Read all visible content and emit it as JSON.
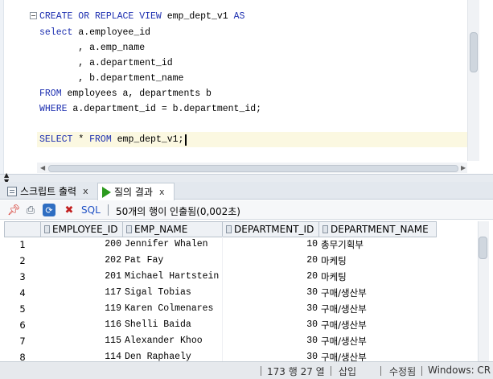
{
  "editor": {
    "lines": [
      [
        {
          "t": "CREATE OR REPLACE VIEW ",
          "k": true
        },
        {
          "t": "emp_dept_v1 ",
          "k": false
        },
        {
          "t": "AS",
          "k": true
        }
      ],
      [
        {
          "t": "select ",
          "k": true
        },
        {
          "t": "a.employee_id",
          "k": false
        }
      ],
      [
        {
          "t": "       , a.emp_name",
          "k": false
        }
      ],
      [
        {
          "t": "       , a.department_id",
          "k": false
        }
      ],
      [
        {
          "t": "       , b.department_name",
          "k": false
        }
      ],
      [
        {
          "t": "FROM ",
          "k": true
        },
        {
          "t": "employees a, departments b",
          "k": false
        }
      ],
      [
        {
          "t": "WHERE ",
          "k": true
        },
        {
          "t": "a.department_id = b.department_id;",
          "k": false
        }
      ],
      [
        {
          "t": "",
          "k": false
        }
      ],
      [
        {
          "t": "SELECT ",
          "k": true
        },
        {
          "t": "* ",
          "k": false
        },
        {
          "t": "FROM ",
          "k": true
        },
        {
          "t": "emp_dept_v1;",
          "k": false
        }
      ]
    ]
  },
  "tabs": {
    "script_output": {
      "label": "스크립트 출력",
      "close": "x"
    },
    "query_result": {
      "label": "질의 결과",
      "close": "x"
    }
  },
  "toolbar": {
    "sql_label": "SQL",
    "status": "50개의 행이 인출됨(0,002초)"
  },
  "grid": {
    "columns": [
      "EMPLOYEE_ID",
      "EMP_NAME",
      "DEPARTMENT_ID",
      "DEPARTMENT_NAME"
    ],
    "rows": [
      {
        "n": "1",
        "id": "200",
        "name": "Jennifer Whalen",
        "dept": "10",
        "dname": "총무기획부"
      },
      {
        "n": "2",
        "id": "202",
        "name": "Pat Fay",
        "dept": "20",
        "dname": "마케팅"
      },
      {
        "n": "3",
        "id": "201",
        "name": "Michael Hartstein",
        "dept": "20",
        "dname": "마케팅"
      },
      {
        "n": "4",
        "id": "117",
        "name": "Sigal Tobias",
        "dept": "30",
        "dname": "구매/생산부"
      },
      {
        "n": "5",
        "id": "119",
        "name": "Karen Colmenares",
        "dept": "30",
        "dname": "구매/생산부"
      },
      {
        "n": "6",
        "id": "116",
        "name": "Shelli Baida",
        "dept": "30",
        "dname": "구매/생산부"
      },
      {
        "n": "7",
        "id": "115",
        "name": "Alexander Khoo",
        "dept": "30",
        "dname": "구매/생산부"
      },
      {
        "n": "8",
        "id": "114",
        "name": "Den Raphaely",
        "dept": "30",
        "dname": "구매/생산부"
      }
    ]
  },
  "statusbar": {
    "position": "173 행 27 열",
    "insert_mode": "삽입",
    "modified": "수정됨",
    "line_ending": "Windows: CR"
  },
  "colors": {
    "keyword": "#1d2fb0",
    "current_line": "#fbf8e1",
    "run_icon": "#2c9a1e"
  }
}
